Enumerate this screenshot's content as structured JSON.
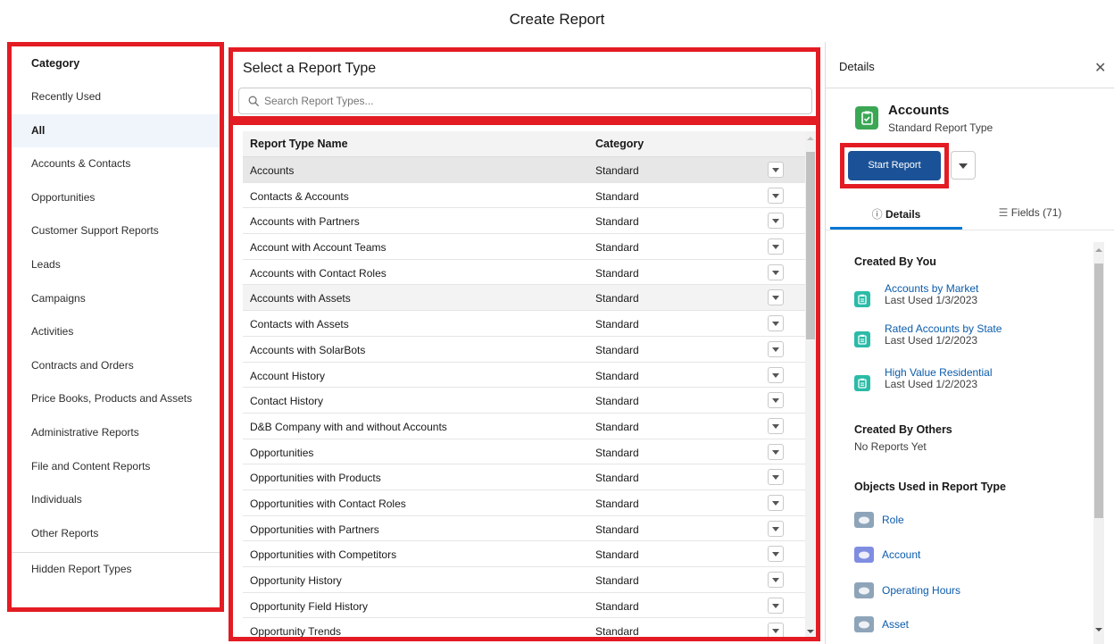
{
  "page": {
    "title": "Create Report"
  },
  "categories": {
    "header": "Category",
    "items": [
      {
        "label": "Recently Used",
        "active": false
      },
      {
        "label": "All",
        "active": true
      },
      {
        "label": "Accounts & Contacts",
        "active": false
      },
      {
        "label": "Opportunities",
        "active": false
      },
      {
        "label": "Customer Support Reports",
        "active": false
      },
      {
        "label": "Leads",
        "active": false
      },
      {
        "label": "Campaigns",
        "active": false
      },
      {
        "label": "Activities",
        "active": false
      },
      {
        "label": "Contracts and Orders",
        "active": false
      },
      {
        "label": "Price Books, Products and Assets",
        "active": false
      },
      {
        "label": "Administrative Reports",
        "active": false
      },
      {
        "label": "File and Content Reports",
        "active": false
      },
      {
        "label": "Individuals",
        "active": false
      },
      {
        "label": "Other Reports",
        "active": false
      }
    ],
    "hidden": "Hidden Report Types"
  },
  "report_types": {
    "title": "Select a Report Type",
    "search_placeholder": "Search Report Types...",
    "columns": {
      "name": "Report Type Name",
      "category": "Category"
    },
    "rows": [
      {
        "name": "Accounts",
        "category": "Standard",
        "state": "selected"
      },
      {
        "name": "Contacts & Accounts",
        "category": "Standard",
        "state": ""
      },
      {
        "name": "Accounts with Partners",
        "category": "Standard",
        "state": ""
      },
      {
        "name": "Account with Account Teams",
        "category": "Standard",
        "state": ""
      },
      {
        "name": "Accounts with Contact Roles",
        "category": "Standard",
        "state": ""
      },
      {
        "name": "Accounts with Assets",
        "category": "Standard",
        "state": "hover"
      },
      {
        "name": "Contacts with Assets",
        "category": "Standard",
        "state": ""
      },
      {
        "name": "Accounts with SolarBots",
        "category": "Standard",
        "state": ""
      },
      {
        "name": "Account History",
        "category": "Standard",
        "state": ""
      },
      {
        "name": "Contact History",
        "category": "Standard",
        "state": ""
      },
      {
        "name": "D&B Company with and without Accounts",
        "category": "Standard",
        "state": ""
      },
      {
        "name": "Opportunities",
        "category": "Standard",
        "state": ""
      },
      {
        "name": "Opportunities with Products",
        "category": "Standard",
        "state": ""
      },
      {
        "name": "Opportunities with Contact Roles",
        "category": "Standard",
        "state": ""
      },
      {
        "name": "Opportunities with Partners",
        "category": "Standard",
        "state": ""
      },
      {
        "name": "Opportunities with Competitors",
        "category": "Standard",
        "state": ""
      },
      {
        "name": "Opportunity History",
        "category": "Standard",
        "state": ""
      },
      {
        "name": "Opportunity Field History",
        "category": "Standard",
        "state": ""
      },
      {
        "name": "Opportunity Trends",
        "category": "Standard",
        "state": ""
      }
    ]
  },
  "details": {
    "title": "Details",
    "close_icon": "close-icon",
    "report_type_name": "Accounts",
    "report_type_kind": "Standard Report Type",
    "start_button": "Start Report",
    "tabs": {
      "details": "Details",
      "fields": "Fields (71)"
    },
    "created_by_you": {
      "title": "Created By You",
      "reports": [
        {
          "name": "Accounts by Market",
          "last_used": "Last Used 1/3/2023"
        },
        {
          "name": "Rated Accounts by State",
          "last_used": "Last Used 1/2/2023"
        },
        {
          "name": "High Value Residential",
          "last_used": "Last Used 1/2/2023"
        }
      ]
    },
    "created_by_others": {
      "title": "Created By Others",
      "empty": "No Reports Yet"
    },
    "objects": {
      "title": "Objects Used in Report Type",
      "items": [
        {
          "name": "Role",
          "icon_color": "#8ea4b9"
        },
        {
          "name": "Account",
          "icon_color": "#7f8de1"
        },
        {
          "name": "Operating Hours",
          "icon_color": "#8ea4b9"
        },
        {
          "name": "Asset",
          "icon_color": "#8ea4b9"
        }
      ]
    }
  },
  "colors": {
    "highlight": "#e31b23",
    "brand_button": "#1b5297",
    "link": "#0b5cab",
    "tab_active": "#0176d3"
  }
}
